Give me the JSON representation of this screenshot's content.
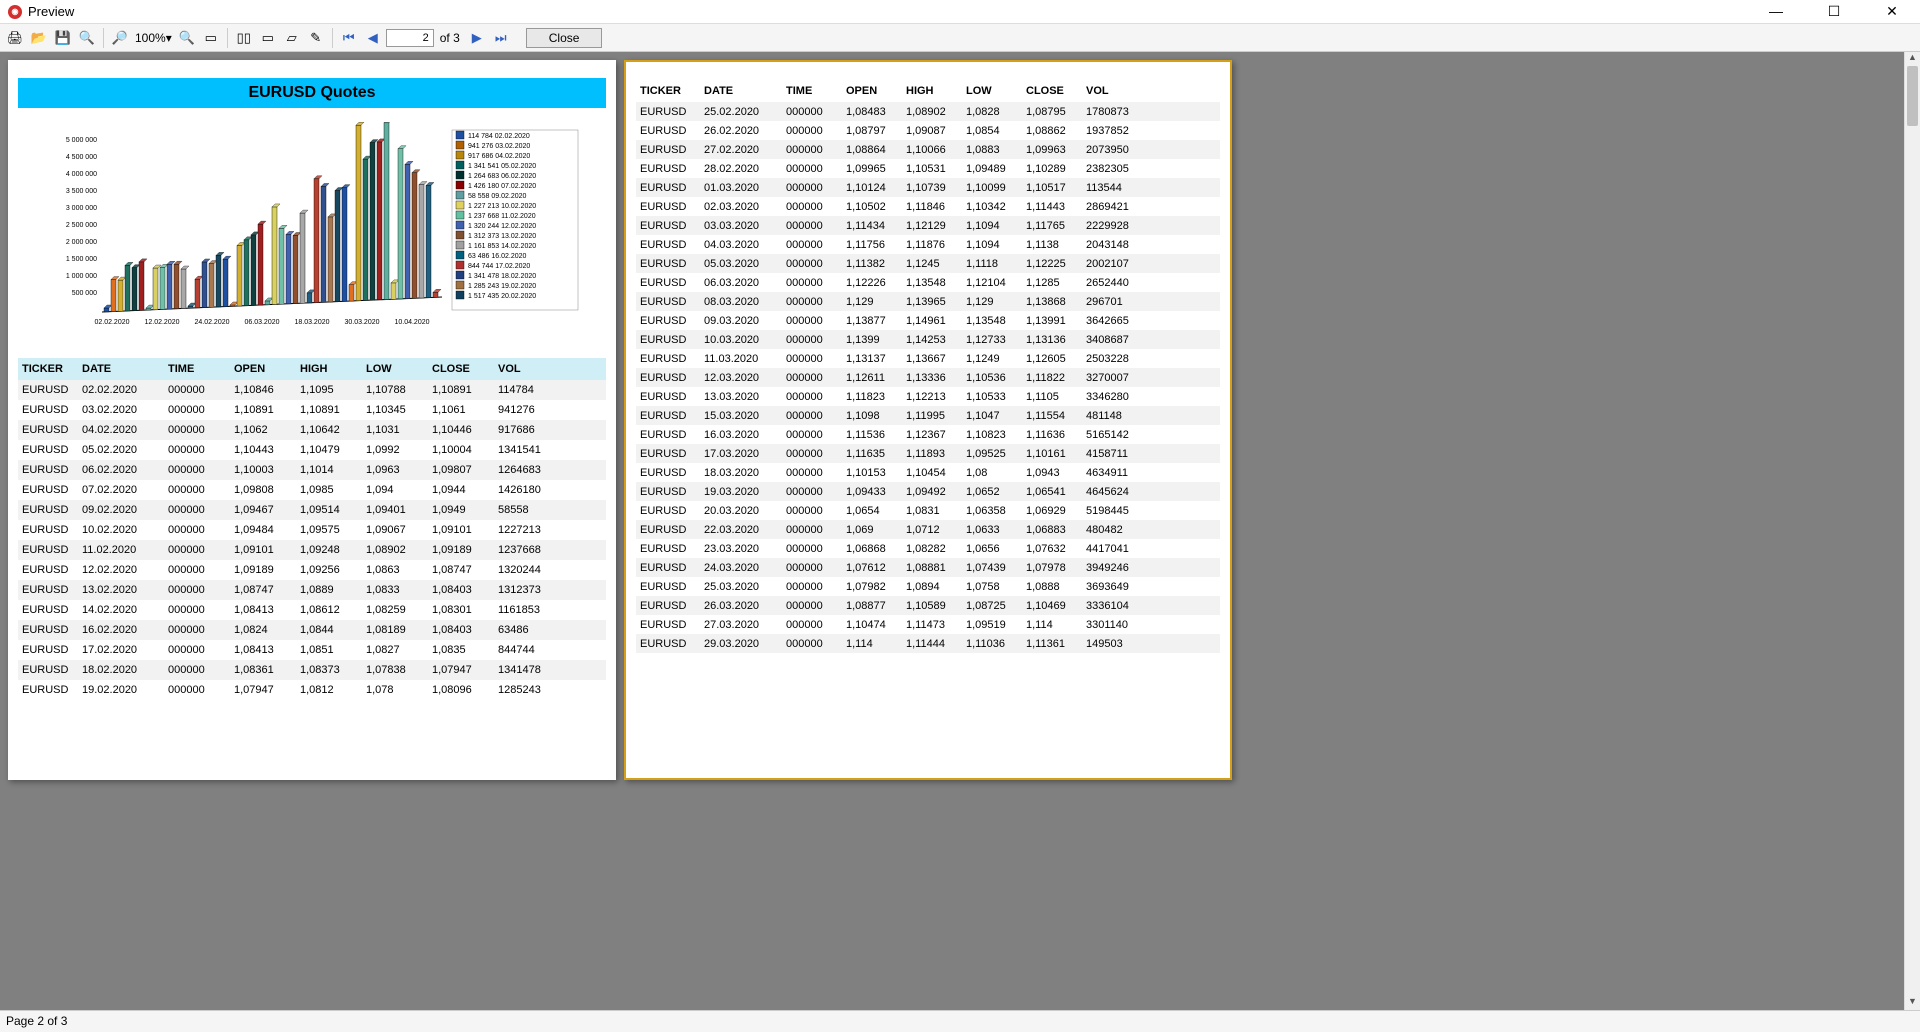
{
  "window": {
    "title": "Preview"
  },
  "toolbar": {
    "zoom": "100%",
    "pageInput": "2",
    "ofPages": "of 3",
    "close": "Close"
  },
  "status": "Page 2 of 3",
  "report": {
    "title": "EURUSD Quotes",
    "columns": [
      "TICKER",
      "DATE",
      "TIME",
      "OPEN",
      "HIGH",
      "LOW",
      "CLOSE",
      "VOL"
    ]
  },
  "chart_data": {
    "type": "bar",
    "title": "EURUSD Quotes",
    "xlabel": "",
    "ylabel": "",
    "ylim": [
      0,
      5000000
    ],
    "x_ticks": [
      "02.02.2020",
      "12.02.2020",
      "24.02.2020",
      "06.03.2020",
      "18.03.2020",
      "30.03.2020",
      "10.04.2020"
    ],
    "y_ticks": [
      "500 000",
      "1 000 000",
      "1 500 000",
      "2 000 000",
      "2 500 000",
      "3 000 000",
      "3 500 000",
      "4 000 000",
      "4 500 000",
      "5 000 000"
    ],
    "legend": [
      "114 784 02.02.2020",
      "941 276 03.02.2020",
      "917 686 04.02.2020",
      "1 341 541 05.02.2020",
      "1 264 683 06.02.2020",
      "1 426 180 07.02.2020",
      "58 558 09.02.2020",
      "1 227 213 10.02.2020",
      "1 237 668 11.02.2020",
      "1 320 244 12.02.2020",
      "1 312 373 13.02.2020",
      "1 161 853 14.02.2020",
      "63 486 16.02.2020",
      "844 744 17.02.2020",
      "1 341 478 18.02.2020",
      "1 285 243 19.02.2020",
      "1 517 435 20.02.2020"
    ],
    "categories": [
      "02.02",
      "03.02",
      "04.02",
      "05.02",
      "06.02",
      "07.02",
      "09.02",
      "10.02",
      "11.02",
      "12.02",
      "13.02",
      "14.02",
      "16.02",
      "17.02",
      "18.02",
      "19.02",
      "20.02",
      "21.02",
      "23.02",
      "25.02",
      "26.02",
      "27.02",
      "28.02",
      "01.03",
      "02.03",
      "03.03",
      "04.03",
      "05.03",
      "06.03",
      "08.03",
      "09.03",
      "10.03",
      "11.03",
      "12.03",
      "13.03",
      "15.03",
      "16.03",
      "17.03",
      "18.03",
      "19.03",
      "20.03",
      "22.03",
      "23.03",
      "24.03",
      "25.03",
      "26.03",
      "27.03",
      "29.03"
    ],
    "values": [
      114784,
      941276,
      917686,
      1341541,
      1264683,
      1426180,
      58558,
      1227213,
      1237668,
      1320244,
      1312373,
      1161853,
      63486,
      844744,
      1341478,
      1285243,
      1517435,
      1396845,
      40103,
      1780873,
      1937852,
      2073950,
      2382305,
      113544,
      2869421,
      2229928,
      2043148,
      2002107,
      2652440,
      296701,
      3642665,
      3408687,
      2503228,
      3270007,
      3346280,
      481148,
      5165142,
      4158711,
      4634911,
      4645624,
      5198445,
      480482,
      4417041,
      3949246,
      3693649,
      3336104,
      3301140,
      149503
    ]
  },
  "page1_rows": [
    [
      "EURUSD",
      "02.02.2020",
      "000000",
      "1,10846",
      "1,1095",
      "1,10788",
      "1,10891",
      "114784"
    ],
    [
      "EURUSD",
      "03.02.2020",
      "000000",
      "1,10891",
      "1,10891",
      "1,10345",
      "1,1061",
      "941276"
    ],
    [
      "EURUSD",
      "04.02.2020",
      "000000",
      "1,1062",
      "1,10642",
      "1,1031",
      "1,10446",
      "917686"
    ],
    [
      "EURUSD",
      "05.02.2020",
      "000000",
      "1,10443",
      "1,10479",
      "1,0992",
      "1,10004",
      "1341541"
    ],
    [
      "EURUSD",
      "06.02.2020",
      "000000",
      "1,10003",
      "1,1014",
      "1,0963",
      "1,09807",
      "1264683"
    ],
    [
      "EURUSD",
      "07.02.2020",
      "000000",
      "1,09808",
      "1,0985",
      "1,094",
      "1,0944",
      "1426180"
    ],
    [
      "EURUSD",
      "09.02.2020",
      "000000",
      "1,09467",
      "1,09514",
      "1,09401",
      "1,0949",
      "58558"
    ],
    [
      "EURUSD",
      "10.02.2020",
      "000000",
      "1,09484",
      "1,09575",
      "1,09067",
      "1,09101",
      "1227213"
    ],
    [
      "EURUSD",
      "11.02.2020",
      "000000",
      "1,09101",
      "1,09248",
      "1,08902",
      "1,09189",
      "1237668"
    ],
    [
      "EURUSD",
      "12.02.2020",
      "000000",
      "1,09189",
      "1,09256",
      "1,0863",
      "1,08747",
      "1320244"
    ],
    [
      "EURUSD",
      "13.02.2020",
      "000000",
      "1,08747",
      "1,0889",
      "1,0833",
      "1,08403",
      "1312373"
    ],
    [
      "EURUSD",
      "14.02.2020",
      "000000",
      "1,08413",
      "1,08612",
      "1,08259",
      "1,08301",
      "1161853"
    ],
    [
      "EURUSD",
      "16.02.2020",
      "000000",
      "1,0824",
      "1,0844",
      "1,08189",
      "1,08403",
      "63486"
    ],
    [
      "EURUSD",
      "17.02.2020",
      "000000",
      "1,08413",
      "1,0851",
      "1,0827",
      "1,0835",
      "844744"
    ],
    [
      "EURUSD",
      "18.02.2020",
      "000000",
      "1,08361",
      "1,08373",
      "1,07838",
      "1,07947",
      "1341478"
    ],
    [
      "EURUSD",
      "19.02.2020",
      "000000",
      "1,07947",
      "1,0812",
      "1,078",
      "1,08096",
      "1285243"
    ]
  ],
  "page2_rows": [
    [
      "EURUSD",
      "25.02.2020",
      "000000",
      "1,08483",
      "1,08902",
      "1,0828",
      "1,08795",
      "1780873"
    ],
    [
      "EURUSD",
      "26.02.2020",
      "000000",
      "1,08797",
      "1,09087",
      "1,0854",
      "1,08862",
      "1937852"
    ],
    [
      "EURUSD",
      "27.02.2020",
      "000000",
      "1,08864",
      "1,10066",
      "1,0883",
      "1,09963",
      "2073950"
    ],
    [
      "EURUSD",
      "28.02.2020",
      "000000",
      "1,09965",
      "1,10531",
      "1,09489",
      "1,10289",
      "2382305"
    ],
    [
      "EURUSD",
      "01.03.2020",
      "000000",
      "1,10124",
      "1,10739",
      "1,10099",
      "1,10517",
      "113544"
    ],
    [
      "EURUSD",
      "02.03.2020",
      "000000",
      "1,10502",
      "1,11846",
      "1,10342",
      "1,11443",
      "2869421"
    ],
    [
      "EURUSD",
      "03.03.2020",
      "000000",
      "1,11434",
      "1,12129",
      "1,1094",
      "1,11765",
      "2229928"
    ],
    [
      "EURUSD",
      "04.03.2020",
      "000000",
      "1,11756",
      "1,11876",
      "1,1094",
      "1,1138",
      "2043148"
    ],
    [
      "EURUSD",
      "05.03.2020",
      "000000",
      "1,11382",
      "1,1245",
      "1,1118",
      "1,12225",
      "2002107"
    ],
    [
      "EURUSD",
      "06.03.2020",
      "000000",
      "1,12226",
      "1,13548",
      "1,12104",
      "1,1285",
      "2652440"
    ],
    [
      "EURUSD",
      "08.03.2020",
      "000000",
      "1,129",
      "1,13965",
      "1,129",
      "1,13868",
      "296701"
    ],
    [
      "EURUSD",
      "09.03.2020",
      "000000",
      "1,13877",
      "1,14961",
      "1,13548",
      "1,13991",
      "3642665"
    ],
    [
      "EURUSD",
      "10.03.2020",
      "000000",
      "1,1399",
      "1,14253",
      "1,12733",
      "1,13136",
      "3408687"
    ],
    [
      "EURUSD",
      "11.03.2020",
      "000000",
      "1,13137",
      "1,13667",
      "1,1249",
      "1,12605",
      "2503228"
    ],
    [
      "EURUSD",
      "12.03.2020",
      "000000",
      "1,12611",
      "1,13336",
      "1,10536",
      "1,11822",
      "3270007"
    ],
    [
      "EURUSD",
      "13.03.2020",
      "000000",
      "1,11823",
      "1,12213",
      "1,10533",
      "1,1105",
      "3346280"
    ],
    [
      "EURUSD",
      "15.03.2020",
      "000000",
      "1,1098",
      "1,11995",
      "1,1047",
      "1,11554",
      "481148"
    ],
    [
      "EURUSD",
      "16.03.2020",
      "000000",
      "1,11536",
      "1,12367",
      "1,10823",
      "1,11636",
      "5165142"
    ],
    [
      "EURUSD",
      "17.03.2020",
      "000000",
      "1,11635",
      "1,11893",
      "1,09525",
      "1,10161",
      "4158711"
    ],
    [
      "EURUSD",
      "18.03.2020",
      "000000",
      "1,10153",
      "1,10454",
      "1,08",
      "1,0943",
      "4634911"
    ],
    [
      "EURUSD",
      "19.03.2020",
      "000000",
      "1,09433",
      "1,09492",
      "1,0652",
      "1,06541",
      "4645624"
    ],
    [
      "EURUSD",
      "20.03.2020",
      "000000",
      "1,0654",
      "1,0831",
      "1,06358",
      "1,06929",
      "5198445"
    ],
    [
      "EURUSD",
      "22.03.2020",
      "000000",
      "1,069",
      "1,0712",
      "1,0633",
      "1,06883",
      "480482"
    ],
    [
      "EURUSD",
      "23.03.2020",
      "000000",
      "1,06868",
      "1,08282",
      "1,0656",
      "1,07632",
      "4417041"
    ],
    [
      "EURUSD",
      "24.03.2020",
      "000000",
      "1,07612",
      "1,08881",
      "1,07439",
      "1,07978",
      "3949246"
    ],
    [
      "EURUSD",
      "25.03.2020",
      "000000",
      "1,07982",
      "1,0894",
      "1,0758",
      "1,0888",
      "3693649"
    ],
    [
      "EURUSD",
      "26.03.2020",
      "000000",
      "1,08877",
      "1,10589",
      "1,08725",
      "1,10469",
      "3336104"
    ],
    [
      "EURUSD",
      "27.03.2020",
      "000000",
      "1,10474",
      "1,11473",
      "1,09519",
      "1,114",
      "3301140"
    ],
    [
      "EURUSD",
      "29.03.2020",
      "000000",
      "1,114",
      "1,11444",
      "1,11036",
      "1,11361",
      "149503"
    ]
  ],
  "legend_colors": [
    "#1e50a2",
    "#b06000",
    "#b8860b",
    "#006060",
    "#003030",
    "#8b0000",
    "#5f9ea0",
    "#e0d060",
    "#60c0a0",
    "#4060b0",
    "#805030",
    "#a0a0a0",
    "#006080",
    "#b03030",
    "#204080",
    "#a07040",
    "#104060"
  ]
}
